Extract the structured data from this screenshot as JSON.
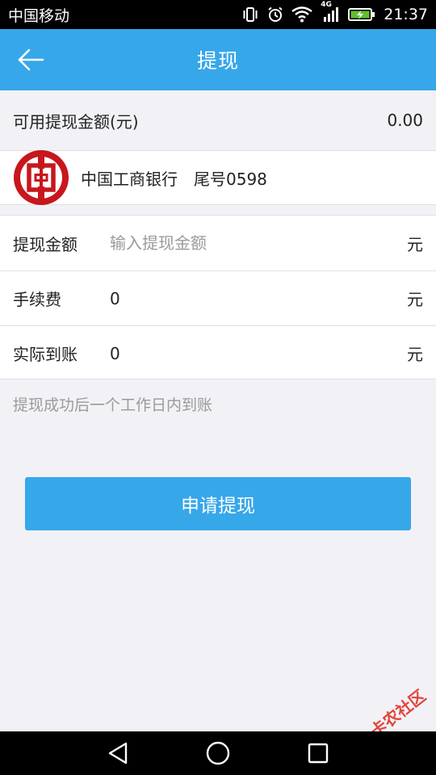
{
  "status_bar": {
    "carrier": "中国移动",
    "network": "4G",
    "time": "21:37",
    "icons": [
      "vibrate-icon",
      "alarm-icon",
      "wifi-icon",
      "signal-icon",
      "battery-charging-icon"
    ]
  },
  "header": {
    "title": "提现",
    "back_icon": "arrow-left-icon"
  },
  "balance": {
    "label": "可用提现金额(元)",
    "value": "0.00"
  },
  "bank": {
    "logo": "icbc-logo",
    "name": "中国工商银行",
    "tail": "尾号0598"
  },
  "form": {
    "amount": {
      "label": "提现金额",
      "placeholder": "输入提现金额",
      "value": "",
      "unit": "元"
    },
    "fee": {
      "label": "手续费",
      "value": "0",
      "unit": "元"
    },
    "actual": {
      "label": "实际到账",
      "value": "0",
      "unit": "元"
    }
  },
  "hint": "提现成功后一个工作日内到账",
  "submit_label": "申请提现",
  "navbar": {
    "icons": [
      "back-triangle-icon",
      "home-circle-icon",
      "recents-square-icon"
    ]
  },
  "watermark": "卡农社区",
  "colors": {
    "accent": "#36a7e9",
    "background": "#f2f2f6",
    "bank_red": "#c8161d",
    "watermark_red": "#e2453c"
  }
}
